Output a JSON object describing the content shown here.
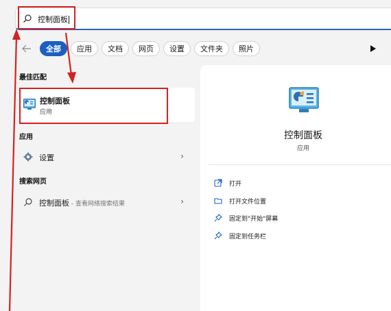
{
  "search": {
    "query": "控制面板"
  },
  "filters": {
    "back_icon": "back-arrow-icon",
    "chips": [
      "全部",
      "应用",
      "文档",
      "网页",
      "设置",
      "文件夹",
      "照片"
    ],
    "active_index": 0
  },
  "best_match": {
    "section_title": "最佳匹配",
    "title": "控制面板",
    "subtitle": "应用"
  },
  "apps": {
    "section_title": "应用",
    "items": [
      {
        "label": "设置",
        "icon": "gear-icon"
      }
    ]
  },
  "web": {
    "section_title": "搜索网页",
    "items": [
      {
        "label": "控制面板",
        "suffix": " - 查看网络搜索结果",
        "icon": "search-icon"
      }
    ]
  },
  "detail": {
    "title": "控制面板",
    "subtitle": "应用",
    "actions": [
      {
        "label": "打开",
        "icon": "open-external-icon"
      },
      {
        "label": "打开文件位置",
        "icon": "folder-icon"
      },
      {
        "label": "固定到\"开始\"屏幕",
        "icon": "pin-icon"
      },
      {
        "label": "固定到任务栏",
        "icon": "pin-icon"
      }
    ]
  },
  "colors": {
    "accent": "#1b5fc1",
    "highlight": "#d42121"
  }
}
